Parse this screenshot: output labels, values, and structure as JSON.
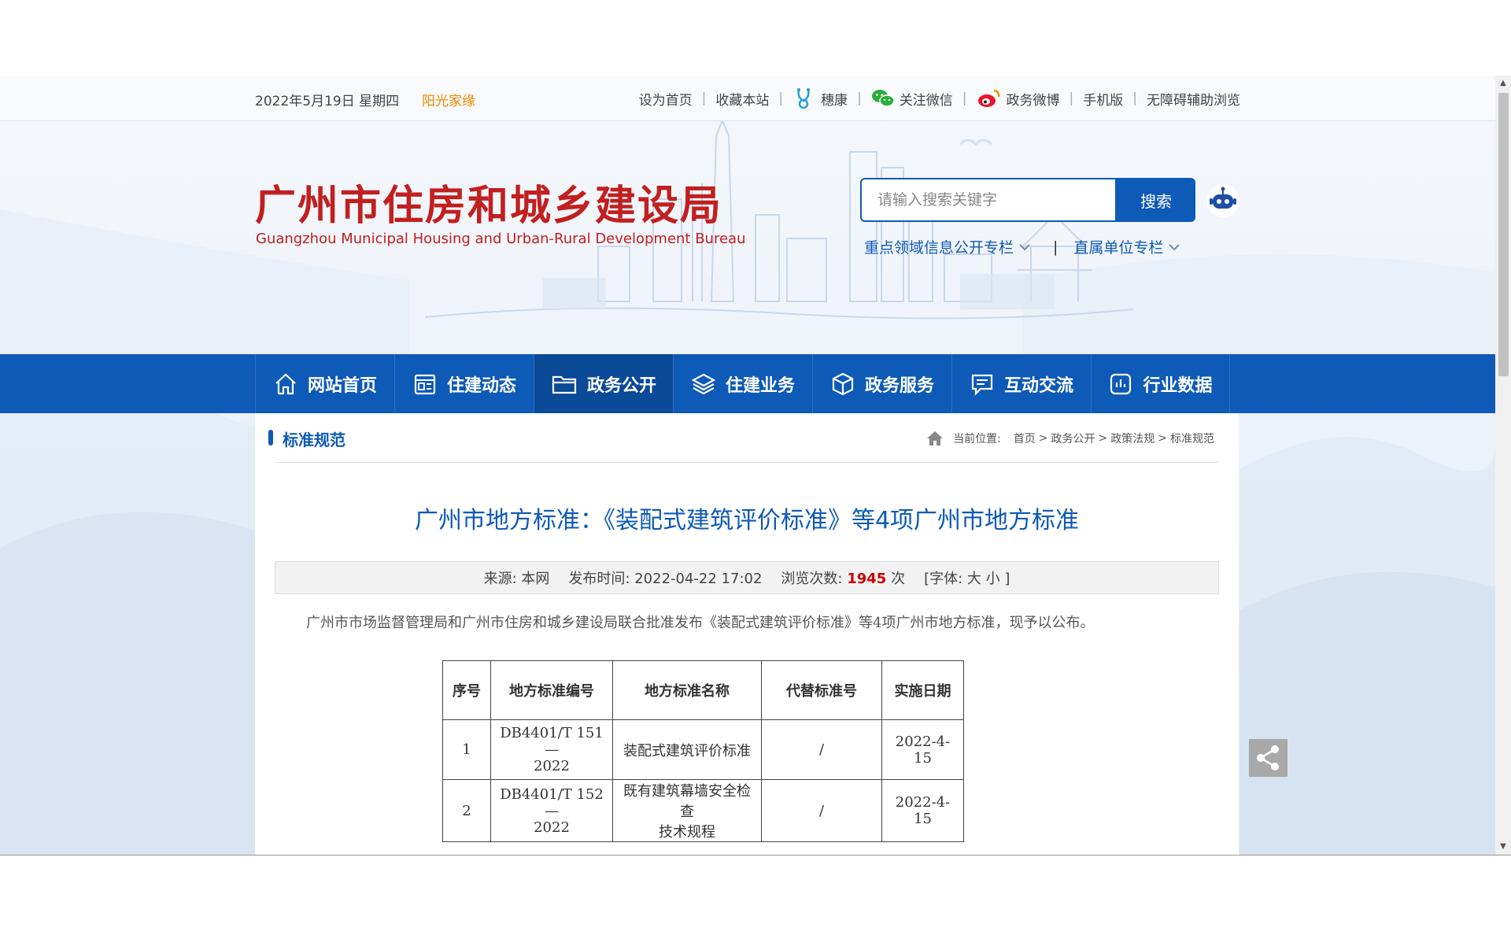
{
  "topbar": {
    "date": "2022年5月19日 星期四",
    "sunshine": "阳光家缘",
    "links": [
      "设为首页",
      "收藏本站",
      "穗康",
      "关注微信",
      "政务微博",
      "手机版",
      "无障碍辅助浏览"
    ]
  },
  "header": {
    "logo_cn": "广州市住房和城乡建设局",
    "logo_en": "Guangzhou Municipal Housing and Urban-Rural Development Bureau",
    "search_placeholder": "请输入搜索关键字",
    "search_button": "搜索",
    "sublink1": "重点领域信息公开专栏",
    "sublink_sep": "|",
    "sublink2": "直属单位专栏"
  },
  "nav": {
    "items": [
      "网站首页",
      "住建动态",
      "政务公开",
      "住建业务",
      "政务服务",
      "互动交流",
      "行业数据"
    ],
    "active": "政务公开"
  },
  "content": {
    "section_title": "标准规范",
    "breadcrumb": {
      "label": "当前位置:",
      "items": [
        "首页",
        "政务公开",
        "政策法规",
        "标准规范"
      ],
      "sep": ">"
    },
    "title": "广州市地方标准：《装配式建筑评价标准》等4项广州市地方标准",
    "meta": {
      "source_label": "来源:",
      "source": "本网",
      "time_label": "发布时间:",
      "time": "2022-04-22 17:02",
      "views_label": "浏览次数:",
      "views": "1945",
      "views_unit": "次",
      "font_open": "[字体:",
      "font_large": "大",
      "font_small": "小",
      "font_close": "]"
    },
    "intro": "广州市市场监督管理局和广州市住房和城乡建设局联合批准发布《装配式建筑评价标准》等4项广州市地方标准，现予以公布。",
    "table": {
      "headers": [
        "序号",
        "地方标准编号",
        "地方标准名称",
        "代替标准号",
        "实施日期"
      ],
      "rows": [
        {
          "no": "1",
          "code1": "DB4401/T 151—",
          "code2": "2022",
          "name1": "装配式建筑评价标准",
          "name2": "",
          "replace": "/",
          "date": "2022-4-15"
        },
        {
          "no": "2",
          "code1": "DB4401/T 152—",
          "code2": "2022",
          "name1": "既有建筑幕墙安全检查",
          "name2": "技术规程",
          "replace": "/",
          "date": "2022-4-15"
        }
      ]
    }
  },
  "colors": {
    "brand_blue": "#0d5ab7",
    "logo_red": "#c21f1f",
    "sunshine_orange": "#f08a00",
    "hits_red": "#cc0000"
  },
  "icons": {
    "suikang": "suikang-icon",
    "wechat": "wechat-icon",
    "weibo": "weibo-icon",
    "robot": "robot-icon",
    "share": "share-icon"
  }
}
